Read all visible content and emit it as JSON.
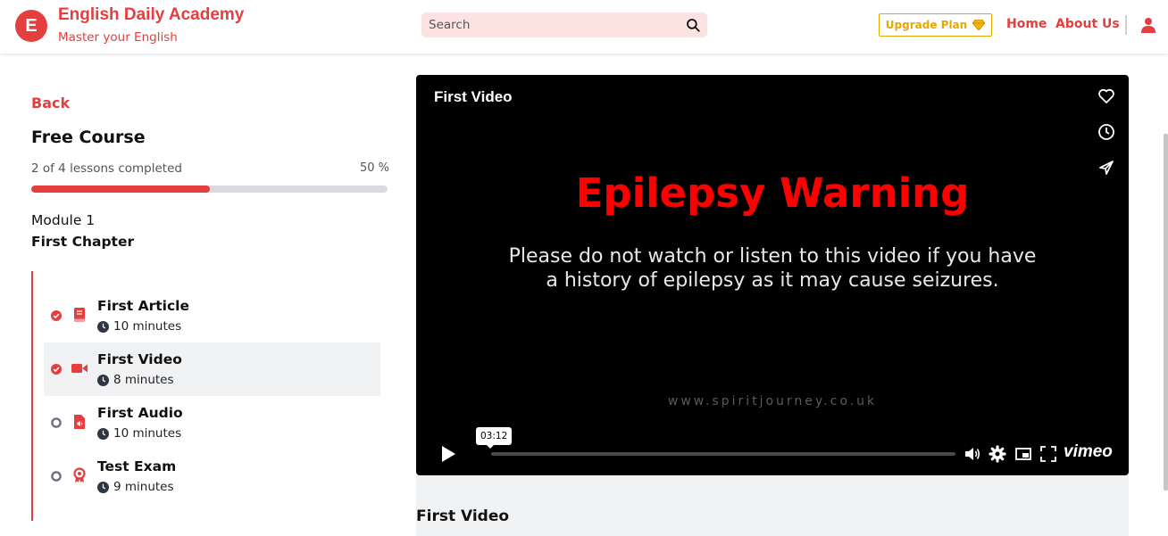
{
  "brand": {
    "logo_letter": "E",
    "title": "English Daily Academy",
    "subtitle": "Master your English"
  },
  "search": {
    "placeholder": "Search"
  },
  "header": {
    "upgrade_label": "Upgrade Plan",
    "nav": [
      "Home",
      "About Us"
    ]
  },
  "course": {
    "back_label": "Back",
    "title": "Free Course",
    "progress_text": "2 of 4 lessons completed",
    "progress_percent_label": "50 %",
    "progress_fraction": 0.5,
    "module_label": "Module 1",
    "chapter_title": "First Chapter",
    "lessons": [
      {
        "name": "First Article",
        "duration": "10 minutes",
        "type": "article",
        "completed": true,
        "active": false
      },
      {
        "name": "First Video",
        "duration": "8 minutes",
        "type": "video",
        "completed": true,
        "active": true
      },
      {
        "name": "First Audio",
        "duration": "10 minutes",
        "type": "audio",
        "completed": false,
        "active": false
      },
      {
        "name": "Test Exam",
        "duration": "9 minutes",
        "type": "exam",
        "completed": false,
        "active": false
      }
    ]
  },
  "player": {
    "title": "First Video",
    "warning_title": "Epilepsy Warning",
    "warning_line1": "Please do not watch or listen to this video if you have",
    "warning_line2": "a history of epilepsy as it may cause seizures.",
    "watermark": "www.spiritjourney.co.uk",
    "time_tooltip": "03:12",
    "brand": "vimeo"
  },
  "below": {
    "title": "First Video"
  },
  "colors": {
    "accent": "#e53e3e",
    "gold": "#e6a800",
    "warning_red": "#ff0000"
  }
}
